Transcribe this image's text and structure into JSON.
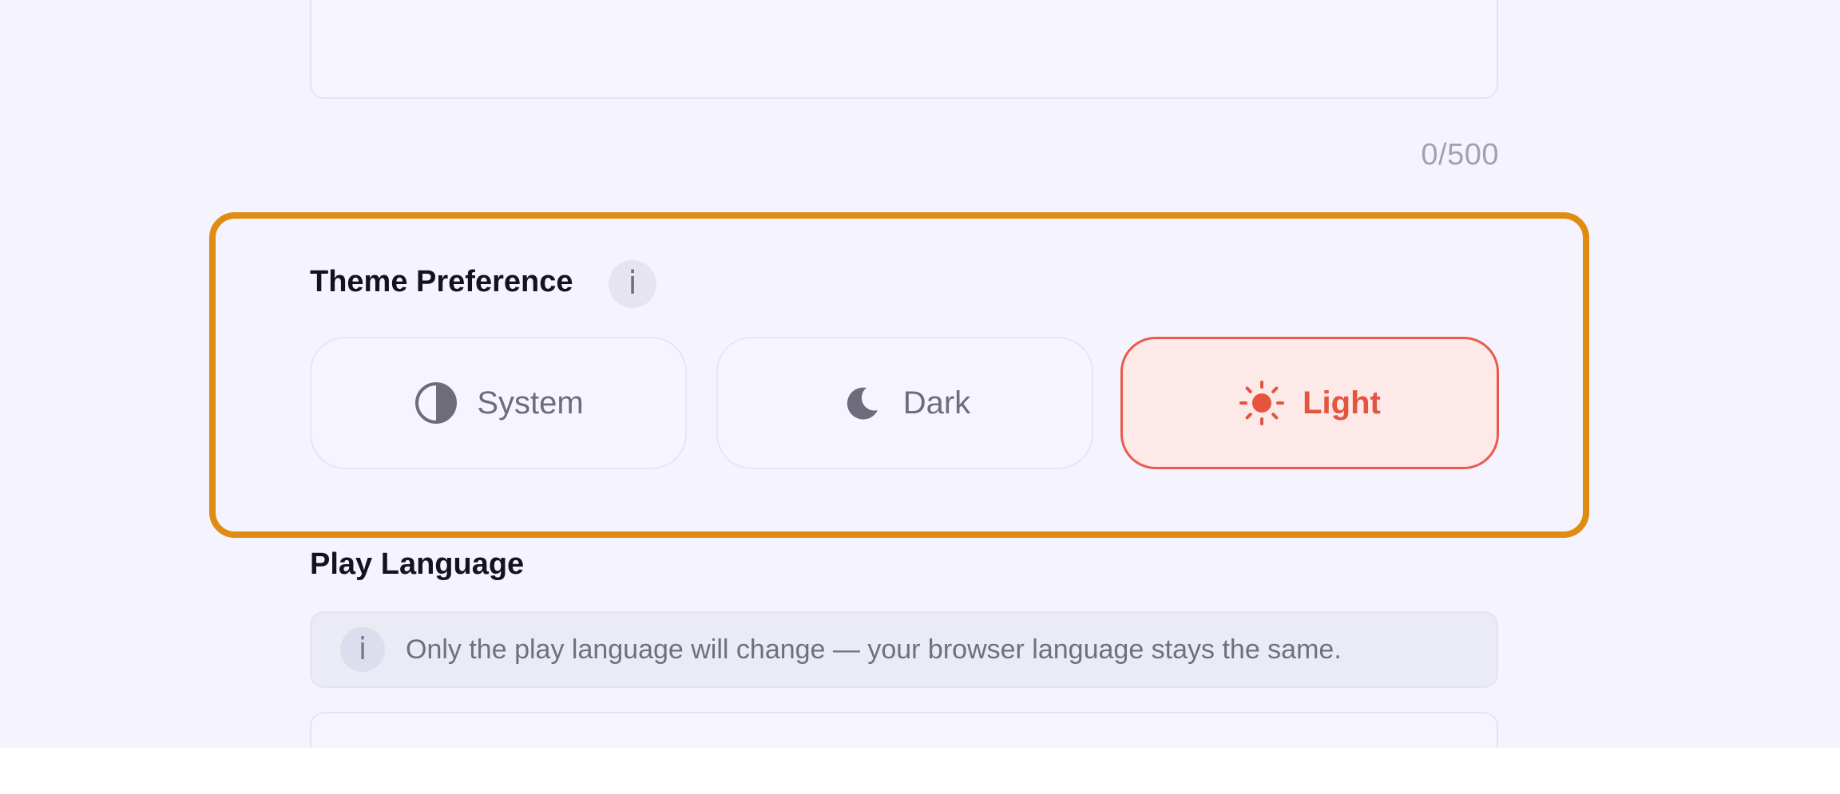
{
  "bio": {
    "value": "",
    "char_count": "0/500"
  },
  "theme_preference": {
    "title": "Theme Preference",
    "info_icon_glyph": "i",
    "options": [
      {
        "label": "System",
        "icon": "half-circle-icon",
        "selected": false
      },
      {
        "label": "Dark",
        "icon": "moon-icon",
        "selected": false
      },
      {
        "label": "Light",
        "icon": "sun-icon",
        "selected": true
      }
    ],
    "selected_color": "#e4543f",
    "highlight_color": "#e08b12"
  },
  "play_language": {
    "title": "Play Language",
    "notice_icon_glyph": "i",
    "notice": "Only the play language will change — your browser language stays the same.",
    "selected_value": ""
  }
}
